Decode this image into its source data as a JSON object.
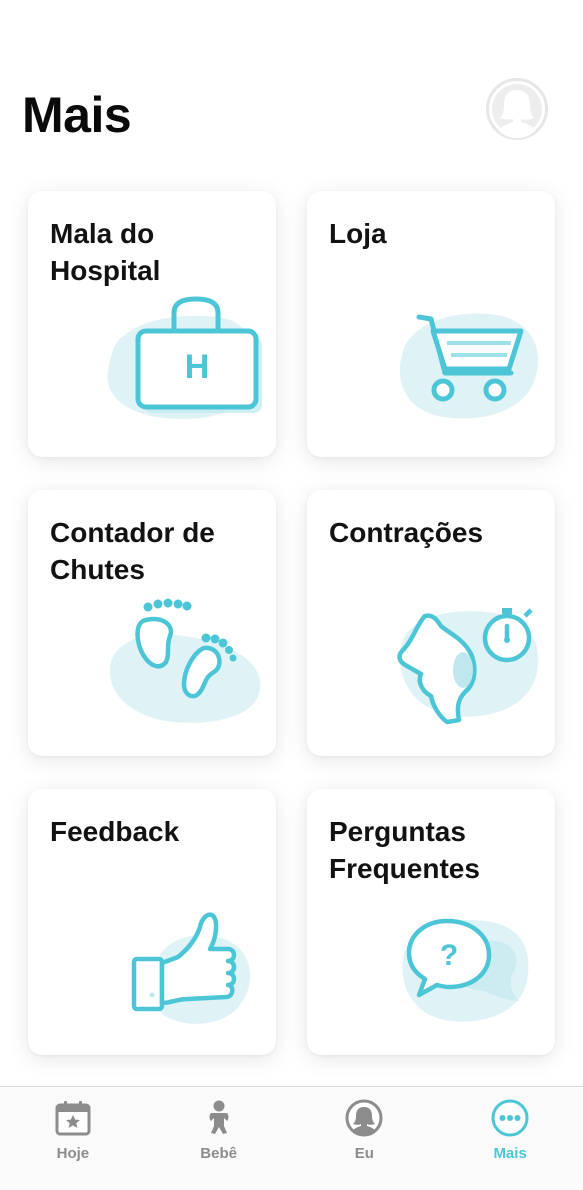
{
  "header": {
    "title": "Mais",
    "profile_icon": "person-avatar-icon"
  },
  "cards": [
    {
      "id": "hospital-bag",
      "label": "Mala do Hospital",
      "icon": "hospital-bag-icon"
    },
    {
      "id": "store",
      "label": "Loja",
      "icon": "shopping-cart-icon"
    },
    {
      "id": "kick-counter",
      "label": "Contador de Chutes",
      "icon": "baby-feet-icon"
    },
    {
      "id": "contractions",
      "label": "Contrações",
      "icon": "pregnant-stopwatch-icon"
    },
    {
      "id": "feedback",
      "label": "Feedback",
      "icon": "thumbs-up-icon"
    },
    {
      "id": "faq",
      "label": "Perguntas Frequentes",
      "icon": "question-bubble-icon"
    }
  ],
  "tabbar": {
    "items": [
      {
        "label": "Hoje",
        "icon": "calendar-star-icon",
        "active": false
      },
      {
        "label": "Bebê",
        "icon": "baby-icon",
        "active": false
      },
      {
        "label": "Eu",
        "icon": "person-icon",
        "active": false
      },
      {
        "label": "Mais",
        "icon": "more-dots-icon",
        "active": true
      }
    ]
  },
  "colors": {
    "accent": "#4cc6d6",
    "accent_light": "#dff3f6",
    "tab_inactive": "#8c8c8c"
  }
}
